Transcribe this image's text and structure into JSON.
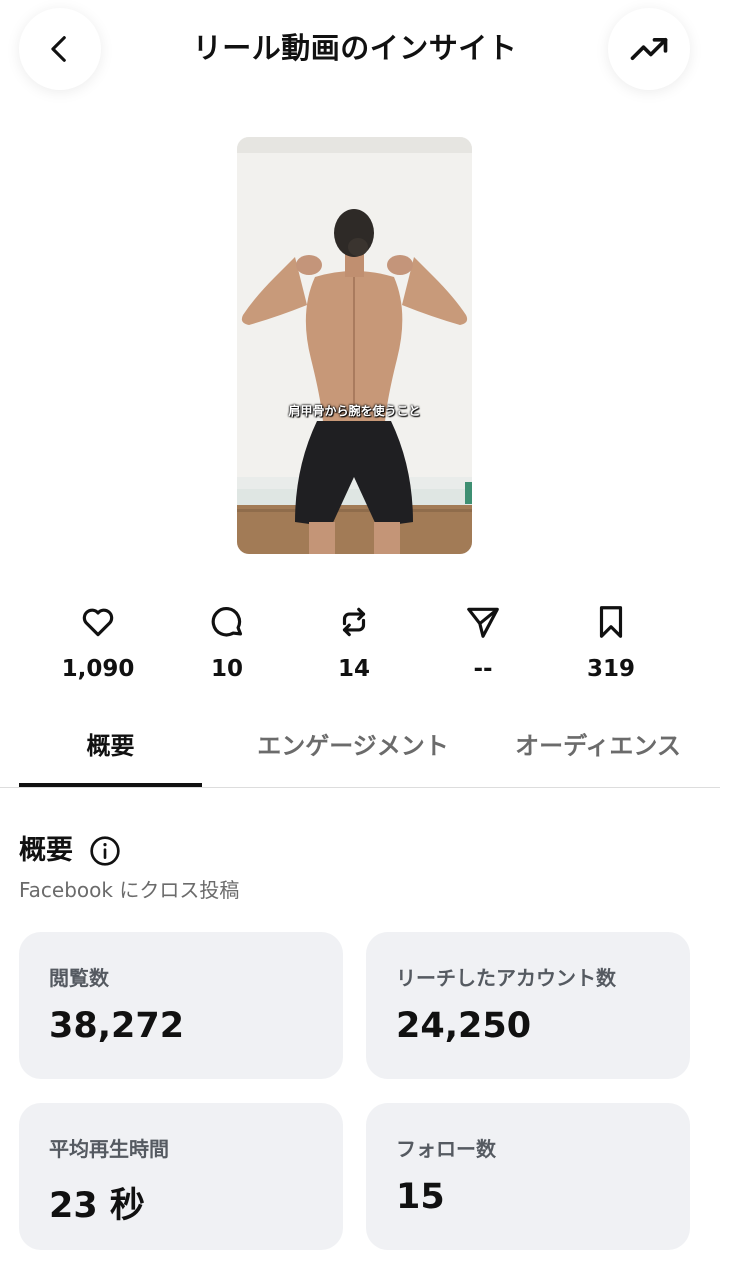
{
  "header": {
    "title": "リール動画のインサイト",
    "back_icon": "chevron-left-icon",
    "trend_icon": "trending-up-icon"
  },
  "thumbnail": {
    "caption": "肩甲骨から腕を使うこと"
  },
  "metrics": [
    {
      "icon": "heart-icon",
      "value": "1,090"
    },
    {
      "icon": "comment-icon",
      "value": "10"
    },
    {
      "icon": "repost-icon",
      "value": "14"
    },
    {
      "icon": "share-icon",
      "value": "--"
    },
    {
      "icon": "bookmark-icon",
      "value": "319"
    }
  ],
  "tabs": [
    {
      "label": "概要",
      "active": true
    },
    {
      "label": "エンゲージメント",
      "active": false
    },
    {
      "label": "オーディエンス",
      "active": false
    }
  ],
  "overview": {
    "title": "概要",
    "info_icon": "info-icon",
    "subtitle": "Facebook にクロス投稿",
    "cards": [
      {
        "label": "閲覧数",
        "value": "38,272"
      },
      {
        "label": "リーチしたアカウント数",
        "value": "24,250"
      },
      {
        "label": "平均再生時間",
        "value": "23 秒"
      },
      {
        "label": "フォロー数",
        "value": "15"
      }
    ]
  },
  "colors": {
    "card_bg": "#f0f1f4",
    "text_primary": "#111111",
    "text_secondary": "#6b6b6b"
  }
}
